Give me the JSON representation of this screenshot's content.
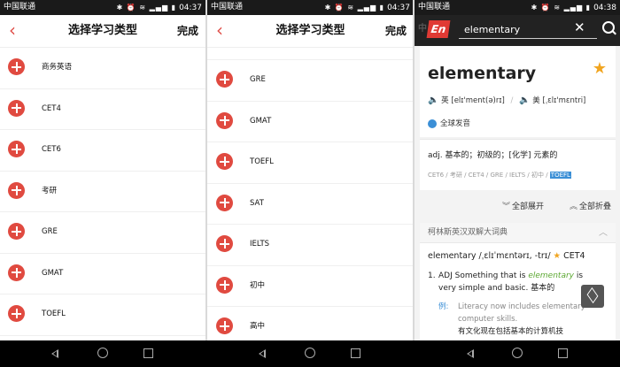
{
  "status": [
    {
      "carrier": "中国联通",
      "icons": "✱ ⏰ ≋ ▂▄▆ ▮",
      "time": "04:37"
    },
    {
      "carrier": "中国联通",
      "icons": "✱ ⏰ ≋ ▂▄▆ ▮",
      "time": "04:37"
    },
    {
      "carrier": "中国联通",
      "icons": "✱ ⏰ ≋ ▂▄▆ ▮",
      "time": "04:38"
    }
  ],
  "type_select": {
    "back_glyph": "‹",
    "title": "选择学习类型",
    "done_label": "完成"
  },
  "panel1_items": [
    "商务英语",
    "CET4",
    "CET6",
    "考研",
    "GRE",
    "GMAT",
    "TOEFL"
  ],
  "panel2_items": [
    "GRE",
    "GMAT",
    "TOEFL",
    "SAT",
    "IELTS",
    "初中",
    "高中"
  ],
  "dict": {
    "logo_bg": "中",
    "logo": "En",
    "search_value": "elementary",
    "clear_glyph": "✕",
    "word": "elementary",
    "star_glyph": "★",
    "pron_uk_label": "英",
    "pron_uk": "[elɪ'ment(ə)rɪ]",
    "pron_us_label": "美",
    "pron_us": "[ˌɛlɪ'mɛntri]",
    "speaker_glyph": "🔈",
    "pron_sep": "/",
    "global_pron": "全球发音",
    "definition": "adj. 基本的；初级的；[化学] 元素的",
    "tags": "CET6 / 考研 / CET4 / GRE / IELTS / 初中 /",
    "tag_highlight": "TOEFL",
    "expand_glyph": "︾",
    "expand_all": "全部展开",
    "fold_glyph": "︽",
    "fold_all": "全部折叠",
    "collins_title": "柯林斯英汉双解大词典",
    "collins_caret": "︿",
    "collins_entry": "elementary /ˌɛlɪˈmɛntərɪ, -trɪ/",
    "collins_star": "★",
    "collins_level": "CET4",
    "sense_num": "1.",
    "sense_pre": "ADJ Something that is",
    "sense_em": "elementary",
    "sense_post": "is very simple and basic. 基本的",
    "example_label": "例:",
    "example_en": "Literacy now includes elementary computer skills.",
    "example_cn": "有文化现在包括基本的计算机技"
  }
}
